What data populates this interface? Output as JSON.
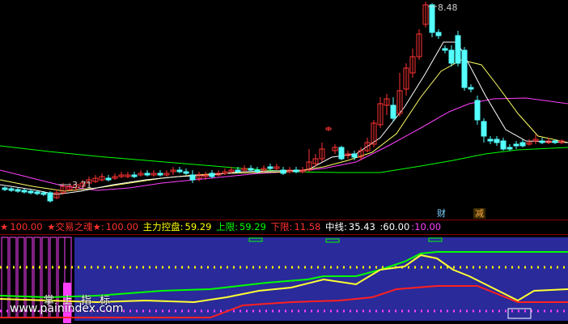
{
  "price_chart": {
    "high_label": "8.48",
    "low_label": "3.71",
    "badges": {
      "cai": "财",
      "jian": "减"
    }
  },
  "legend": {
    "items": [
      {
        "text": "★",
        "color": "#ff3030"
      },
      {
        "text": "100.00",
        "color": "#ff3030"
      },
      {
        "text": "★交易之魂★:",
        "color": "#ff3030"
      },
      {
        "text": "100.00",
        "color": "#ff3030"
      },
      {
        "text": "主力控盘:",
        "color": "#ffff00"
      },
      {
        "text": "59.29",
        "color": "#ffff00"
      },
      {
        "text": "上限:",
        "color": "#00ff00"
      },
      {
        "text": "59.29",
        "color": "#00ff00"
      },
      {
        "text": "下限:",
        "color": "#ff3030"
      },
      {
        "text": "11.58",
        "color": "#ff3030"
      },
      {
        "text": "中线:",
        "color": "#ffffff"
      },
      {
        "text": "35.43",
        "color": "#ffffff"
      },
      {
        "text": ":60.00",
        "color": "#ffffff"
      },
      {
        "text": ":10.00",
        "color": "#ff40ff"
      }
    ]
  },
  "watermark": {
    "cn": "掌上指标",
    "url": "www.painindex.com"
  },
  "colors": {
    "up": "#ff3232",
    "down": "#54ffff",
    "ma_white": "#ffffff",
    "ma_yellow": "#ffff66",
    "ma_magenta": "#ff40ff",
    "ma_green": "#00ff00",
    "panel_bg": "#2a2a9a"
  }
}
